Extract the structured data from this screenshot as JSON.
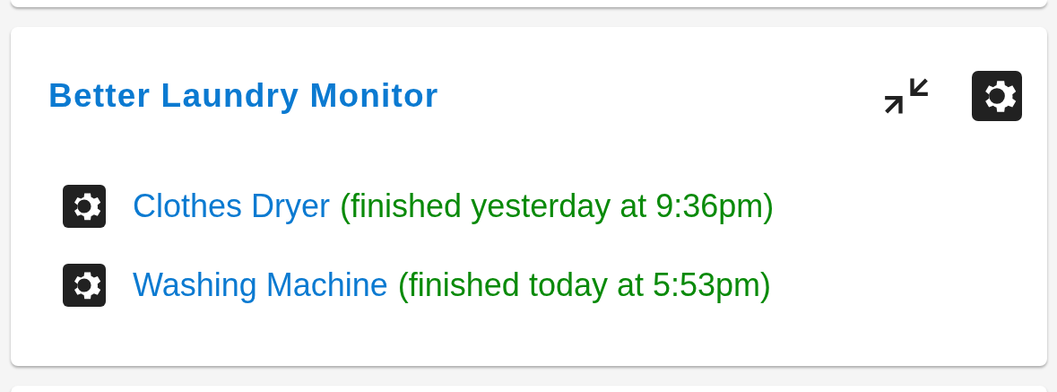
{
  "card": {
    "title": "Better Laundry Monitor",
    "devices": [
      {
        "name": "Clothes Dryer",
        "status": "(finished yesterday at 9:36pm)"
      },
      {
        "name": "Washing Machine",
        "status": "(finished today at 5:53pm)"
      }
    ]
  }
}
